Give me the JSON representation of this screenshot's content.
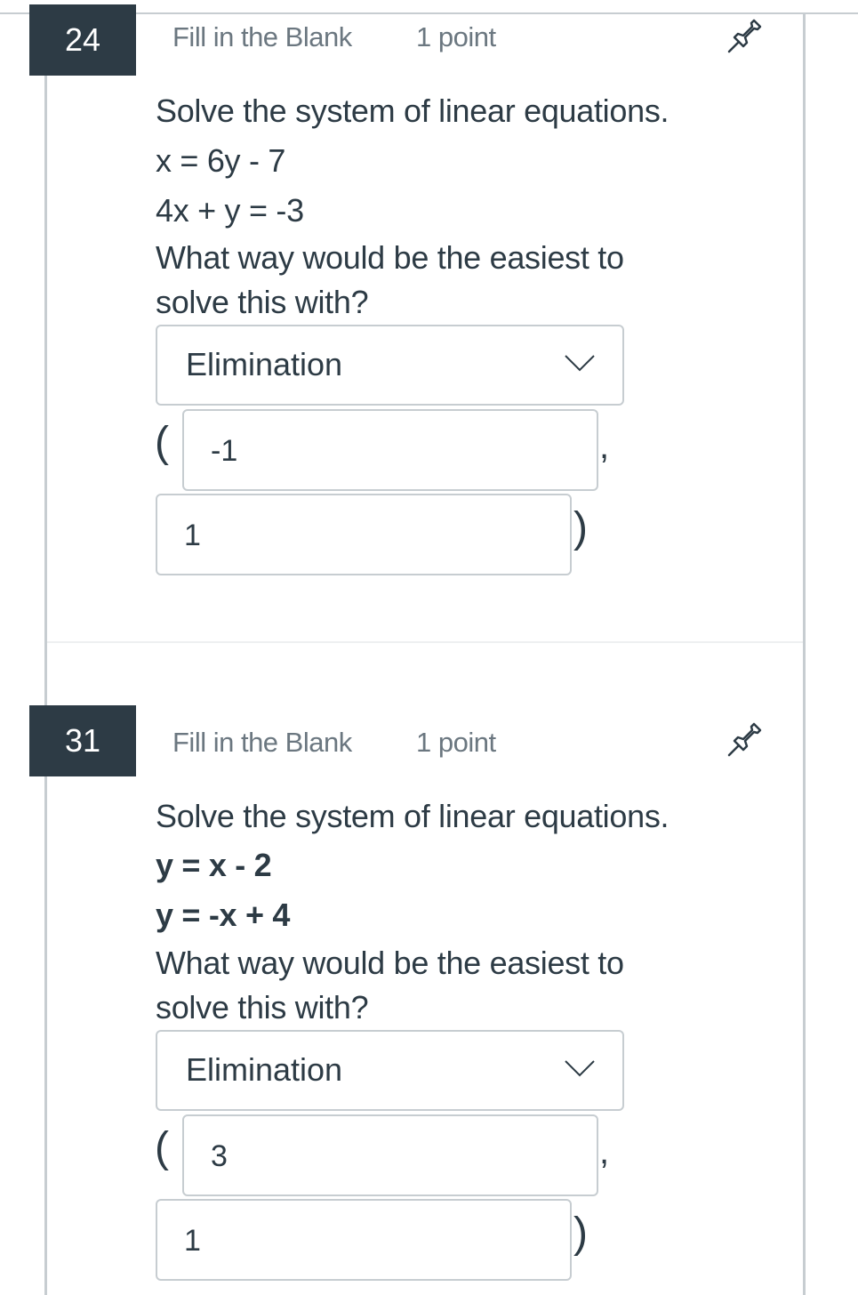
{
  "questions": [
    {
      "number": "24",
      "type": "Fill in the Blank",
      "points": "1 point",
      "prompt": "Solve the system of linear equations.",
      "equations": [
        "x = 6y - 7",
        "4x + y = -3"
      ],
      "question_line1": "What way would be the easiest to",
      "question_line2": "solve this with?",
      "method_selected": "Elimination",
      "open_paren": "(",
      "comma": ",",
      "close_paren": ")",
      "x_value": "-1",
      "y_value": "1"
    },
    {
      "number": "31",
      "type": "Fill in the Blank",
      "points": "1 point",
      "prompt": "Solve the system of linear equations.",
      "equations": [
        "y = x - 2",
        "y = -x + 4"
      ],
      "question_line1": "What way would be the easiest to",
      "question_line2": "solve this with?",
      "method_selected": "Elimination",
      "open_paren": "(",
      "comma": ",",
      "close_paren": ")",
      "x_value": "3",
      "y_value": "1"
    }
  ],
  "icons": {
    "pin": "pushpin-icon",
    "dropdown": "chevron-down-icon"
  },
  "colors": {
    "badge_bg": "#2d3b45",
    "text": "#2d3b45",
    "muted": "#6b7780",
    "border": "#c7cdd1"
  }
}
